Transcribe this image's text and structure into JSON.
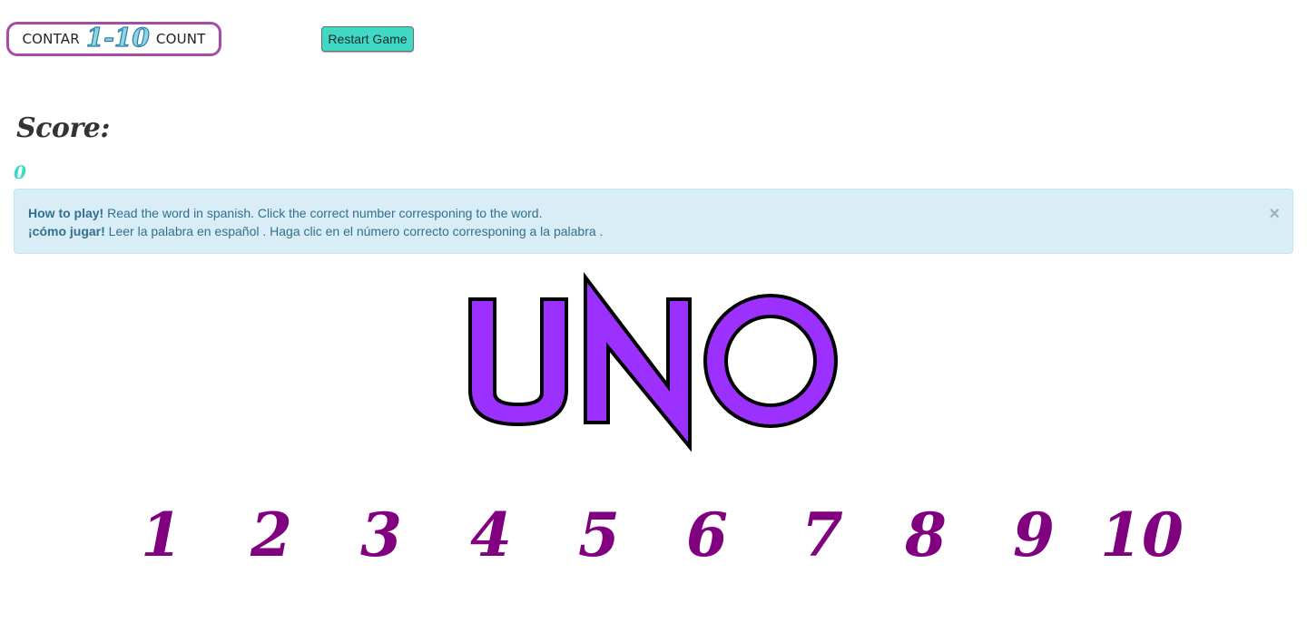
{
  "logo": {
    "left_word": "CONTAR",
    "range": "1-10",
    "right_word": "COUNT"
  },
  "restart_button": {
    "label": "Restart Game"
  },
  "score": {
    "label": "Score:",
    "value": "0"
  },
  "alert": {
    "line1_bold": "How to play!",
    "line1_text": " Read the word in spanish. Click the correct number corresponing to the word.",
    "line2_bold": "¡cómo jugar!",
    "line2_text": " Leer la palabra en español . Haga clic en el número correcto corresponing a la palabra .",
    "close": "×"
  },
  "word": {
    "text": "UNO",
    "fill": "#9b30ff",
    "stroke": "#000000"
  },
  "numbers": [
    "1",
    "2",
    "3",
    "4",
    "5",
    "6",
    "7",
    "8",
    "9",
    "10"
  ],
  "colors": {
    "number": "#800080",
    "accent": "#3fd9c6",
    "logo_border": "#a64ca6"
  }
}
